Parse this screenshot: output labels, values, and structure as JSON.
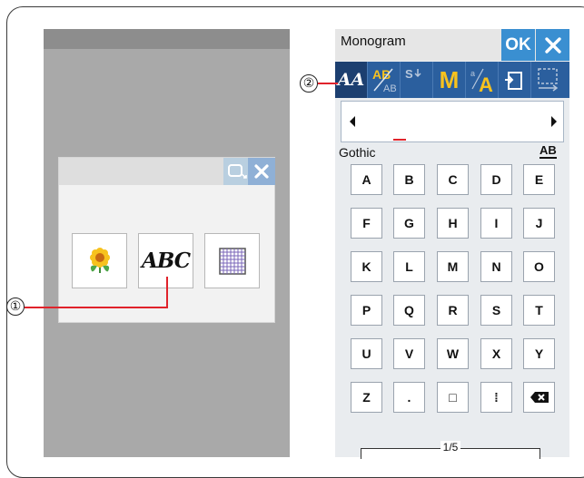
{
  "callouts": {
    "one": "①",
    "two": "②"
  },
  "left_dialog": {
    "tiles": [
      {
        "name": "embroidery-design",
        "icon": "flower-icon"
      },
      {
        "name": "monogram",
        "icon": "abc-script-icon",
        "label": "ABC"
      },
      {
        "name": "grid",
        "icon": "grid-icon"
      }
    ]
  },
  "monogram": {
    "title": "Monogram",
    "ok_label": "OK",
    "font_name": "Gothic",
    "case_label": "AB",
    "page_indicator": "1/5",
    "toolbar": [
      {
        "name": "font-select",
        "icon": "script-aa-icon"
      },
      {
        "name": "layout",
        "icon": "ab-layout-icon"
      },
      {
        "name": "size-s",
        "icon": "size-s-icon",
        "label": "S"
      },
      {
        "name": "size-m",
        "icon": "size-m-icon",
        "label": "M"
      },
      {
        "name": "case",
        "icon": "small-large-a-icon",
        "label": "A"
      },
      {
        "name": "preview",
        "icon": "open-file-icon"
      },
      {
        "name": "arrange",
        "icon": "dashed-arrange-icon"
      }
    ],
    "keys": [
      [
        "A",
        "B",
        "C",
        "D",
        "E"
      ],
      [
        "F",
        "G",
        "H",
        "I",
        "J"
      ],
      [
        "K",
        "L",
        "M",
        "N",
        "O"
      ],
      [
        "P",
        "Q",
        "R",
        "S",
        "T"
      ],
      [
        "U",
        "V",
        "W",
        "X",
        "Y"
      ],
      [
        "Z",
        ".",
        "□",
        "⁞",
        "⌫"
      ]
    ]
  },
  "colors": {
    "accent_blue": "#3a8fd1",
    "toolbar_blue": "#2b5f9e",
    "callout_line": "#e0232b",
    "yellow": "#f7c21e"
  }
}
